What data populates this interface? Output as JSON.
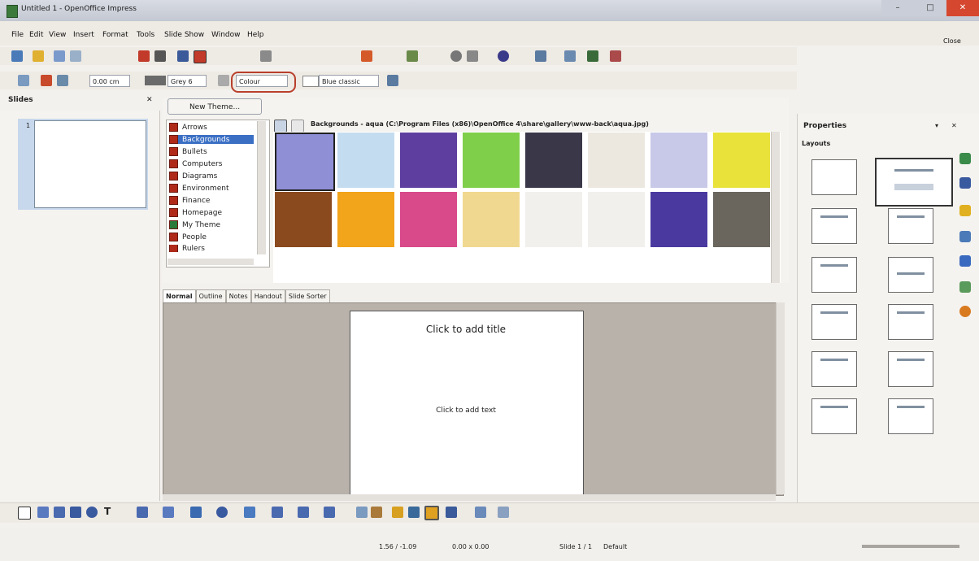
{
  "window": {
    "title": "Untitled 1 - OpenOffice Impress",
    "close_doc_label": "Close"
  },
  "menu": [
    "File",
    "Edit",
    "View",
    "Insert",
    "Format",
    "Tools",
    "Slide Show",
    "Window",
    "Help"
  ],
  "line_toolbar": {
    "width_value": "0.00 cm",
    "line_color": "Grey 6",
    "fill_style": "Colour",
    "fill_color": "Blue classic"
  },
  "slides_pane": {
    "label": "Slides",
    "slide_number": "1"
  },
  "gallery": {
    "new_theme_button": "New Theme...",
    "themes": [
      "Arrows",
      "Backgrounds",
      "Bullets",
      "Computers",
      "Diagrams",
      "Environment",
      "Finance",
      "Homepage",
      "My Theme",
      "People",
      "Rulers"
    ],
    "selected_theme": "Backgrounds",
    "path_label": "Backgrounds - aqua (C:\\Program Files (x86)\\OpenOffice 4\\share\\gallery\\www-back\\aqua.jpg)",
    "tiles_row1": [
      "#8f8fd6",
      "#c4dcef",
      "#5e3fa0",
      "#7fcf4a",
      "#3a3848",
      "#ece8e0",
      "#c8c8e8",
      "#e8e23a"
    ],
    "tiles_row2": [
      "#8a4a1e",
      "#f2a41a",
      "#d84a8a",
      "#f0d890",
      "#f2f0ec",
      "#f2f0ec",
      "#4a3aa0",
      "#6a665e"
    ]
  },
  "view_tabs": [
    "Normal",
    "Outline",
    "Notes",
    "Handout",
    "Slide Sorter"
  ],
  "slide": {
    "title_placeholder": "Click to add title",
    "body_placeholder": "Click to add text"
  },
  "properties": {
    "label": "Properties",
    "section": "Layouts"
  },
  "status": {
    "position": "1.56 / -1.09",
    "size": "0.00 x 0.00",
    "slide_info": "Slide 1 / 1",
    "master": "Default"
  }
}
